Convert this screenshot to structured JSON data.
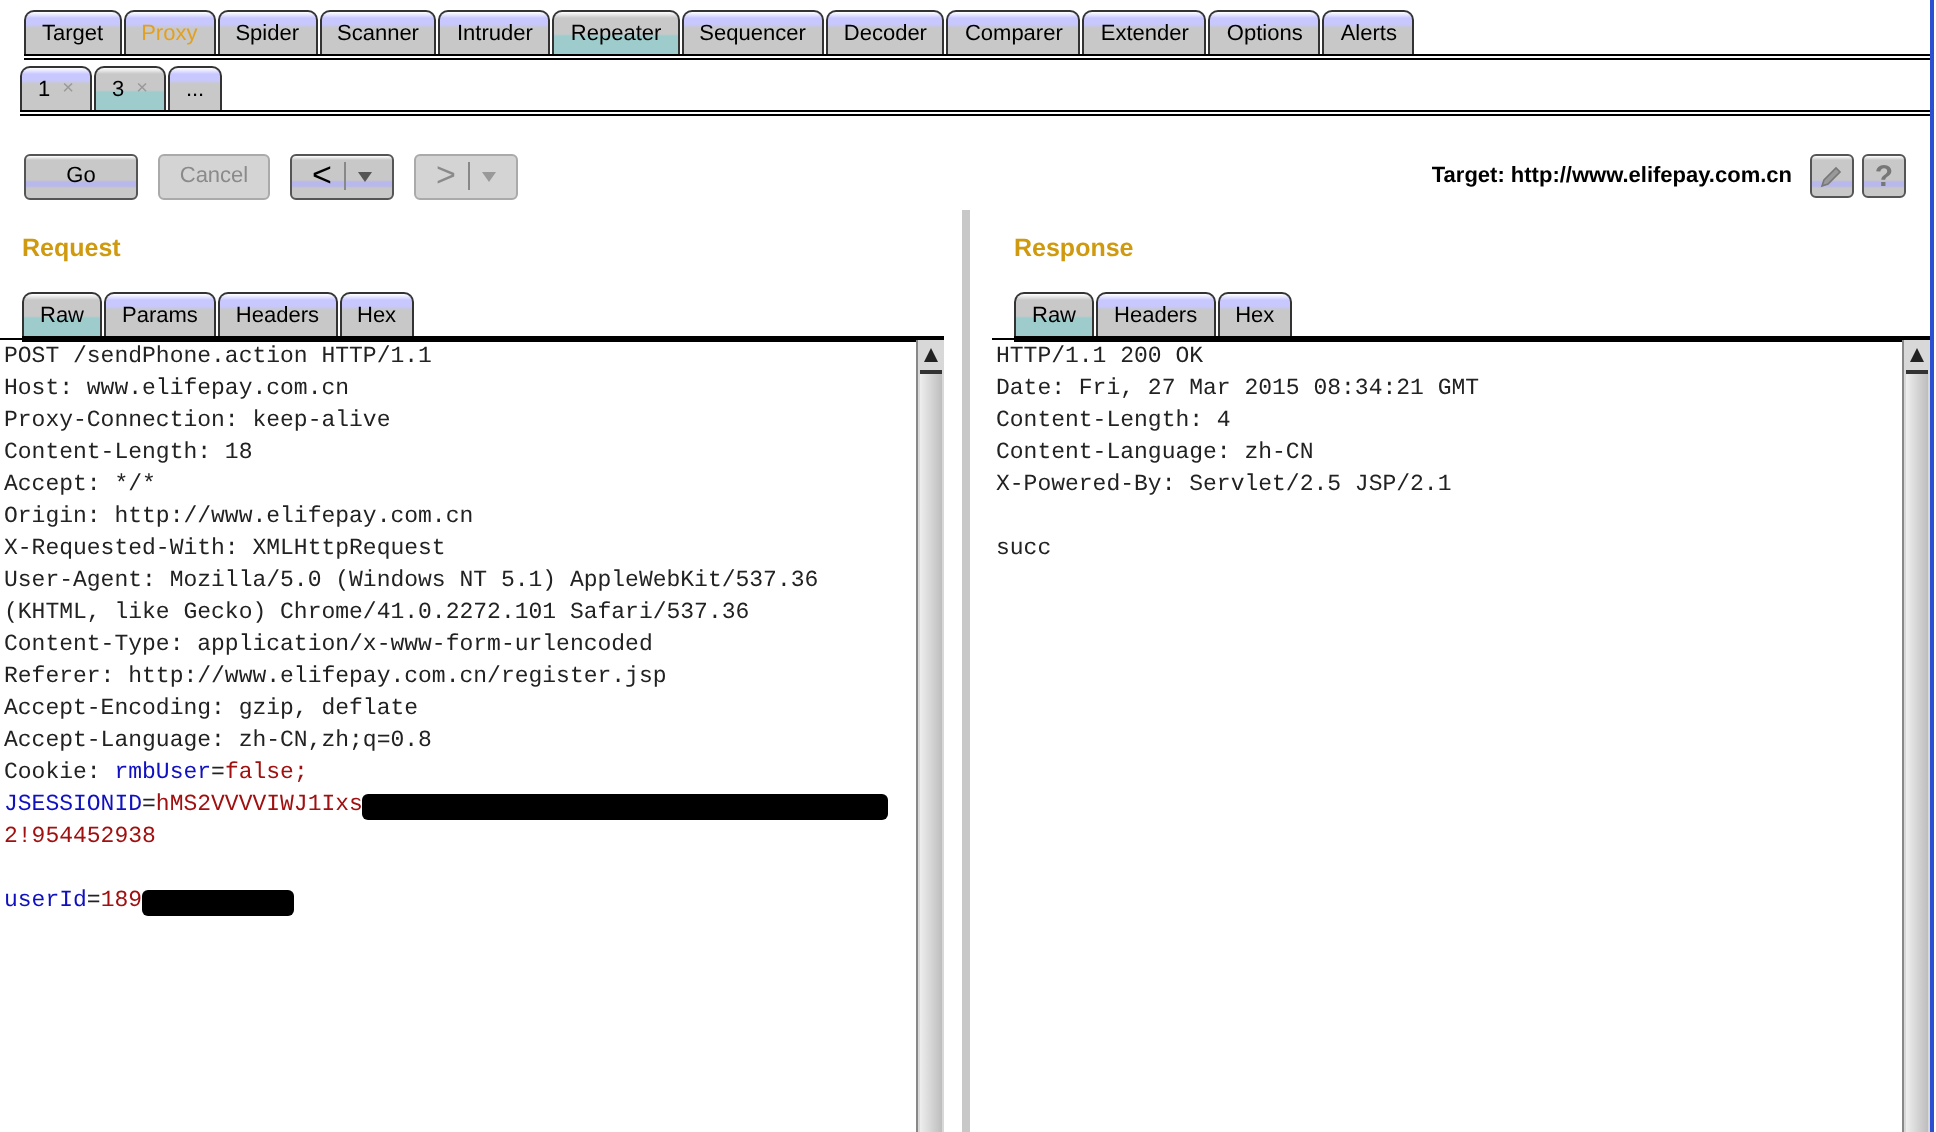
{
  "main_tabs": [
    {
      "label": "Target",
      "selected": false,
      "highlighted": false
    },
    {
      "label": "Proxy",
      "selected": false,
      "highlighted": true
    },
    {
      "label": "Spider",
      "selected": false,
      "highlighted": false
    },
    {
      "label": "Scanner",
      "selected": false,
      "highlighted": false
    },
    {
      "label": "Intruder",
      "selected": false,
      "highlighted": false
    },
    {
      "label": "Repeater",
      "selected": true,
      "highlighted": false
    },
    {
      "label": "Sequencer",
      "selected": false,
      "highlighted": false
    },
    {
      "label": "Decoder",
      "selected": false,
      "highlighted": false
    },
    {
      "label": "Comparer",
      "selected": false,
      "highlighted": false
    },
    {
      "label": "Extender",
      "selected": false,
      "highlighted": false
    },
    {
      "label": "Options",
      "selected": false,
      "highlighted": false
    },
    {
      "label": "Alerts",
      "selected": false,
      "highlighted": false
    }
  ],
  "repeater_tabs": [
    {
      "label": "1",
      "close": "×",
      "selected": false
    },
    {
      "label": "3",
      "close": "×",
      "selected": true
    },
    {
      "label": "...",
      "selected": false
    }
  ],
  "toolbar": {
    "go": {
      "label": "Go",
      "disabled": false
    },
    "cancel": {
      "label": "Cancel",
      "disabled": true
    },
    "back": {
      "label": "<",
      "disabled": false
    },
    "forward": {
      "label": ">",
      "disabled": true
    },
    "target": "Target: http://www.elifepay.com.cn",
    "help": "?"
  },
  "request": {
    "title": "Request",
    "tabs": [
      {
        "label": "Raw",
        "selected": true
      },
      {
        "label": "Params",
        "selected": false
      },
      {
        "label": "Headers",
        "selected": false
      },
      {
        "label": "Hex",
        "selected": false
      }
    ],
    "lines": [
      {
        "kind": "text",
        "segments": [
          {
            "kind": "plain",
            "text": "POST /sendPhone.action HTTP/1.1"
          }
        ]
      },
      {
        "kind": "text",
        "segments": [
          {
            "kind": "plain",
            "text": "Host: www.elifepay.com.cn"
          }
        ]
      },
      {
        "kind": "text",
        "segments": [
          {
            "kind": "plain",
            "text": "Proxy-Connection: keep-alive"
          }
        ]
      },
      {
        "kind": "text",
        "segments": [
          {
            "kind": "plain",
            "text": "Content-Length: 18"
          }
        ]
      },
      {
        "kind": "text",
        "segments": [
          {
            "kind": "plain",
            "text": "Accept: */*"
          }
        ]
      },
      {
        "kind": "text",
        "segments": [
          {
            "kind": "plain",
            "text": "Origin: http://www.elifepay.com.cn"
          }
        ]
      },
      {
        "kind": "text",
        "segments": [
          {
            "kind": "plain",
            "text": "X-Requested-With: XMLHttpRequest"
          }
        ]
      },
      {
        "kind": "text",
        "segments": [
          {
            "kind": "plain",
            "text": "User-Agent: Mozilla/5.0 (Windows NT 5.1) AppleWebKit/537.36"
          }
        ]
      },
      {
        "kind": "text",
        "segments": [
          {
            "kind": "plain",
            "text": "(KHTML, like Gecko) Chrome/41.0.2272.101 Safari/537.36"
          }
        ]
      },
      {
        "kind": "text",
        "segments": [
          {
            "kind": "plain",
            "text": "Content-Type: application/x-www-form-urlencoded"
          }
        ]
      },
      {
        "kind": "text",
        "segments": [
          {
            "kind": "plain",
            "text": "Referer: http://www.elifepay.com.cn/register.jsp"
          }
        ]
      },
      {
        "kind": "text",
        "segments": [
          {
            "kind": "plain",
            "text": "Accept-Encoding: gzip, deflate"
          }
        ]
      },
      {
        "kind": "text",
        "segments": [
          {
            "kind": "plain",
            "text": "Accept-Language: zh-CN,zh;q=0.8"
          }
        ]
      },
      {
        "kind": "text",
        "segments": [
          {
            "kind": "plain",
            "text": "Cookie: "
          },
          {
            "kind": "name",
            "text": "rmbUser"
          },
          {
            "kind": "plain",
            "text": "="
          },
          {
            "kind": "value",
            "text": "false;"
          }
        ]
      },
      {
        "kind": "text",
        "segments": [
          {
            "kind": "name",
            "text": "JSESSIONID"
          },
          {
            "kind": "plain",
            "text": "="
          },
          {
            "kind": "value",
            "text": "hMS2VVVVIWJ1Ixs"
          },
          {
            "kind": "redacted"
          }
        ]
      },
      {
        "kind": "text",
        "segments": [
          {
            "kind": "value",
            "text": "2!954452938"
          }
        ]
      },
      {
        "kind": "blank"
      },
      {
        "kind": "text",
        "segments": [
          {
            "kind": "name",
            "text": "userId"
          },
          {
            "kind": "plain",
            "text": "="
          },
          {
            "kind": "value",
            "text": "189"
          },
          {
            "kind": "masked"
          }
        ]
      }
    ]
  },
  "response": {
    "title": "Response",
    "tabs": [
      {
        "label": "Raw",
        "selected": true
      },
      {
        "label": "Headers",
        "selected": false
      },
      {
        "label": "Hex",
        "selected": false
      }
    ],
    "lines": [
      {
        "kind": "text",
        "segments": [
          {
            "kind": "plain",
            "text": "HTTP/1.1 200 OK"
          }
        ]
      },
      {
        "kind": "text",
        "segments": [
          {
            "kind": "plain",
            "text": "Date: Fri, 27 Mar 2015 08:34:21 GMT"
          }
        ]
      },
      {
        "kind": "text",
        "segments": [
          {
            "kind": "plain",
            "text": "Content-Length: 4"
          }
        ]
      },
      {
        "kind": "text",
        "segments": [
          {
            "kind": "plain",
            "text": "Content-Language: zh-CN"
          }
        ]
      },
      {
        "kind": "text",
        "segments": [
          {
            "kind": "plain",
            "text": "X-Powered-By: Servlet/2.5 JSP/2.1"
          }
        ]
      },
      {
        "kind": "blank"
      },
      {
        "kind": "text",
        "segments": [
          {
            "kind": "plain",
            "text": "succ"
          }
        ]
      }
    ]
  }
}
